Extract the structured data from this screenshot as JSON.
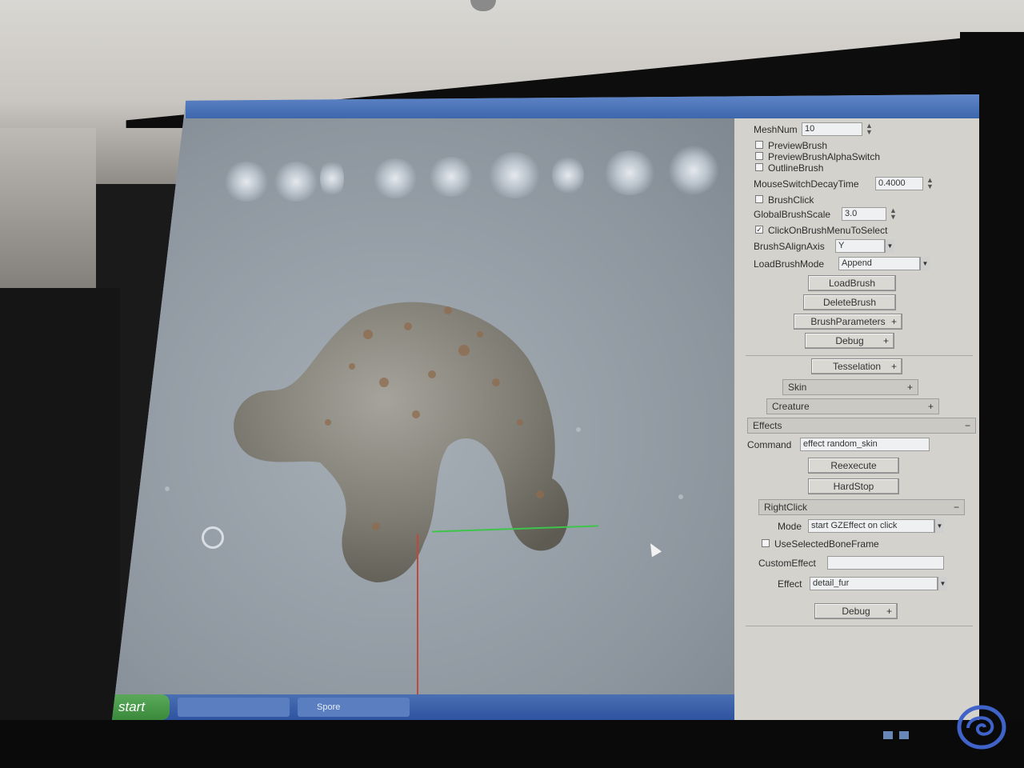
{
  "panel": {
    "mesh_num": {
      "label": "MeshNum",
      "value": "10"
    },
    "checkboxes_top": [
      {
        "label": "PreviewBrush",
        "checked": false
      },
      {
        "label": "PreviewBrushAlphaSwitch",
        "checked": false
      },
      {
        "label": "OutlineBrush",
        "checked": false
      }
    ],
    "mouse_switch": {
      "label": "MouseSwitchDecayTime",
      "value": "0.4000"
    },
    "brush_click": {
      "label": "BrushClick",
      "checked": false
    },
    "global_brush_scale": {
      "label": "GlobalBrushScale",
      "value": "3.0"
    },
    "click_on_brush": {
      "label": "ClickOnBrushMenuToSelect",
      "checked": true
    },
    "brush_align_axis": {
      "label": "BrushSAlignAxis",
      "value": "Y"
    },
    "load_brush_mode": {
      "label": "LoadBrushMode",
      "value": "Append"
    },
    "buttons": {
      "load_brush": "LoadBrush",
      "delete_brush": "DeleteBrush",
      "brush_parameters": "BrushParameters",
      "debug_top": "Debug",
      "tesselation": "Tesselation",
      "reexecute": "Reexecute",
      "hard_stop": "HardStop",
      "debug_bottom": "Debug"
    },
    "sections": {
      "skin": "Skin",
      "creature": "Creature",
      "effects": "Effects",
      "right_click": "RightClick"
    },
    "command": {
      "label": "Command",
      "value": "effect random_skin"
    },
    "mode": {
      "label": "Mode",
      "value": "start GZEffect on click"
    },
    "use_selected_bone": {
      "label": "UseSelectedBoneFrame",
      "checked": false
    },
    "custom_effect": {
      "label": "CustomEffect",
      "value": ""
    },
    "effect": {
      "label": "Effect",
      "value": "detail_fur"
    },
    "plus": "+",
    "minus": "−"
  },
  "taskbar": {
    "start_label": "start",
    "tasks": [
      "",
      "Spore"
    ]
  },
  "colors": {
    "viewport": "#9aa3ad",
    "panel": "#d3d2cc",
    "taskbar": "#2e53a0",
    "axis_x": "#3dc44a",
    "axis_y": "#c0493b"
  }
}
